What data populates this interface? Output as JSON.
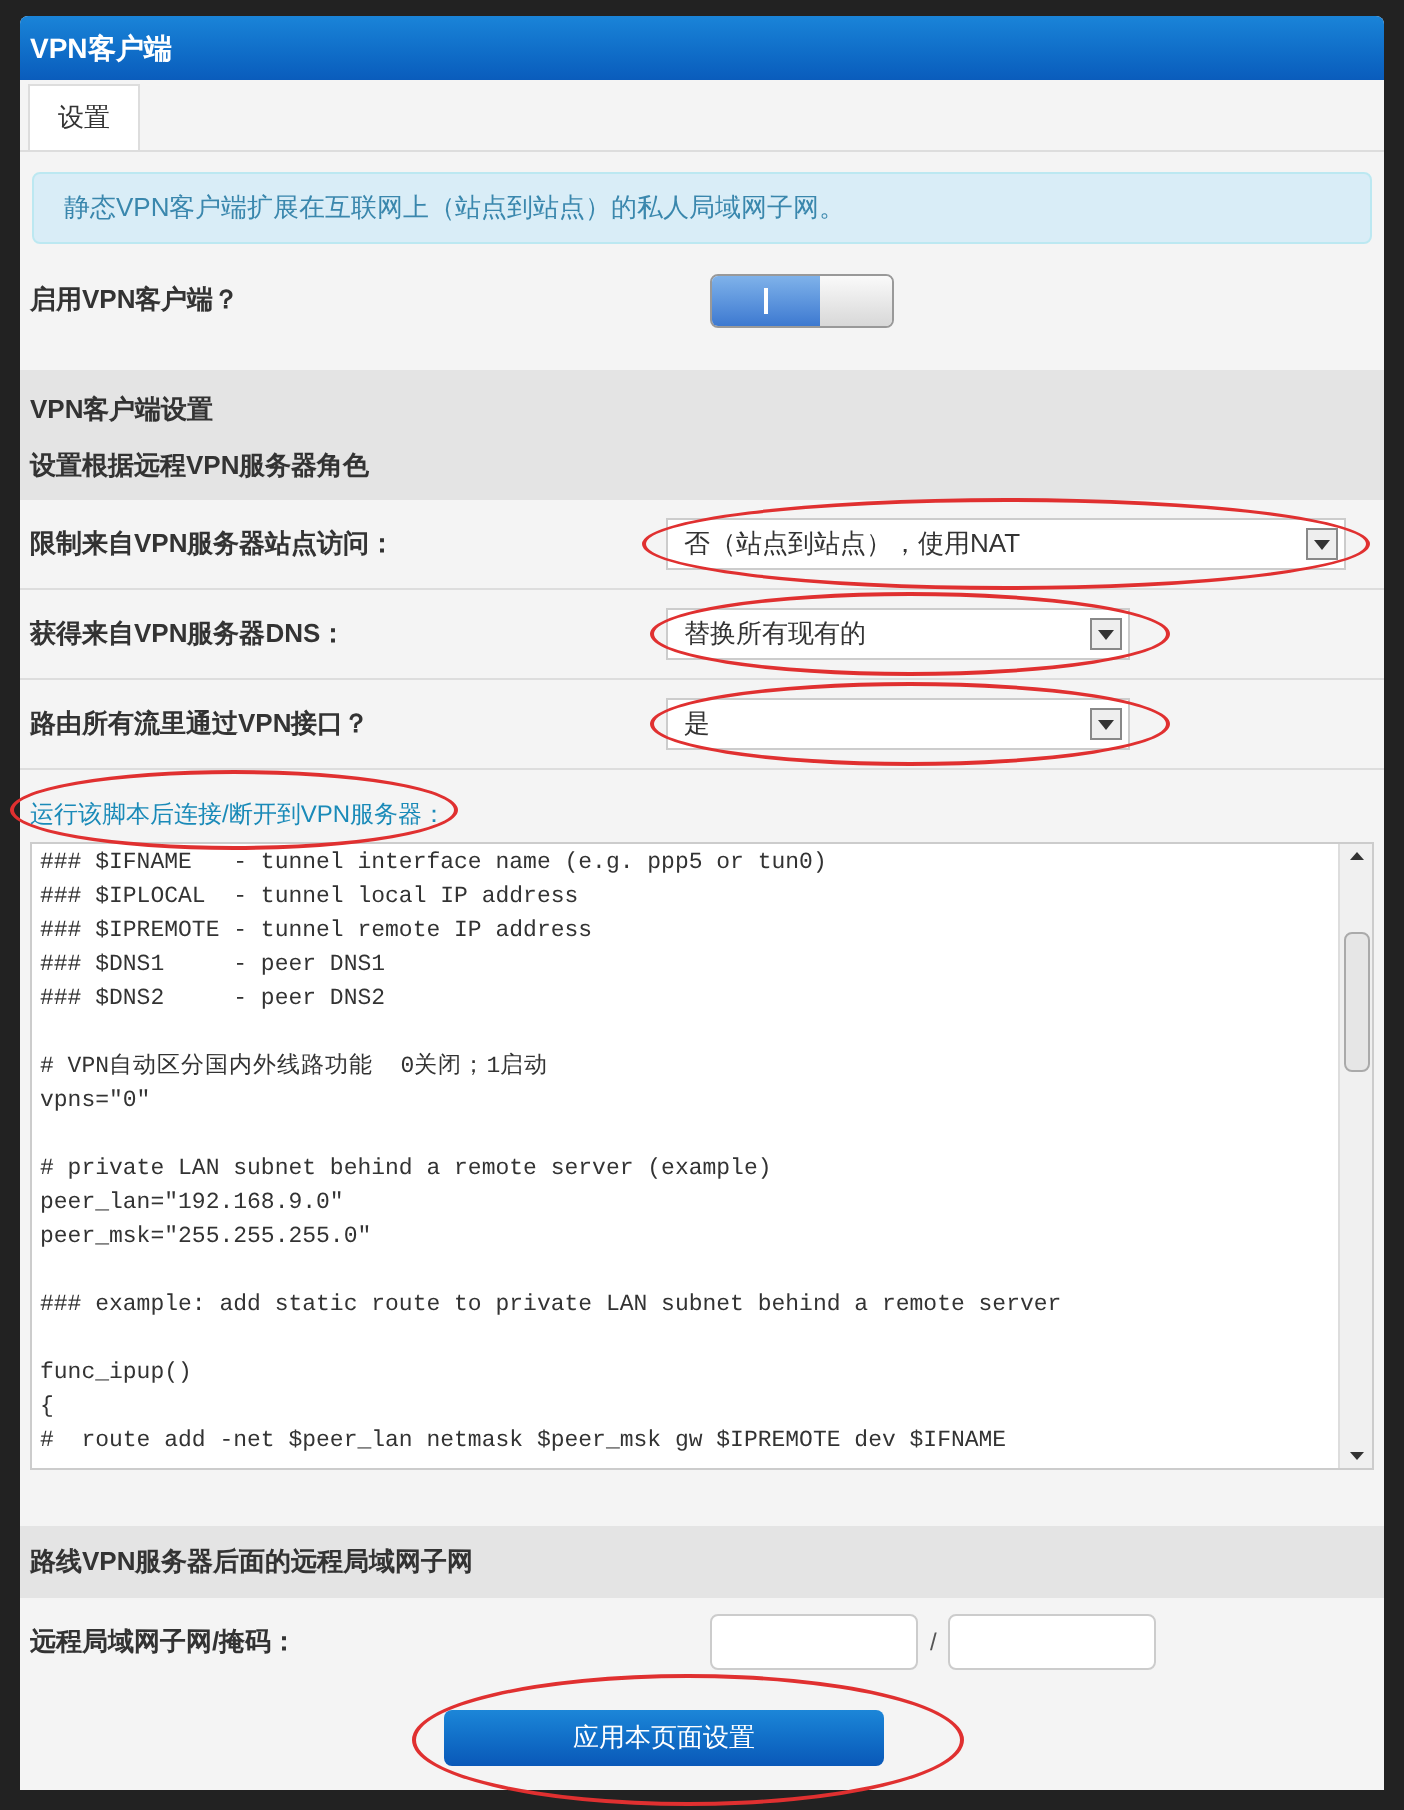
{
  "window": {
    "title": "VPN客户端"
  },
  "tabs": [
    {
      "label": "设置",
      "selected": true
    }
  ],
  "info": "静态VPN客户端扩展在互联网上（站点到站点）的私人局域网子网。",
  "enable": {
    "label": "启用VPN客户端？",
    "on": true
  },
  "section1": {
    "title": "VPN客户端设置",
    "subtitle": "设置根据远程VPN服务器角色"
  },
  "selects": [
    {
      "label": "限制来自VPN服务器站点访问：",
      "value": "否（站点到站点），使用NAT",
      "wide": true,
      "circled": true
    },
    {
      "label": "获得来自VPN服务器DNS：",
      "value": "替换所有现有的",
      "wide": false,
      "circled": true
    },
    {
      "label": "路由所有流里通过VPN接口？",
      "value": "是",
      "wide": false,
      "circled": true
    }
  ],
  "script": {
    "label": "运行该脚本后连接/断开到VPN服务器：",
    "blocks": [
      [
        "### $IFNAME   - tunnel interface name (e.g. ppp5 or tun0)",
        "### $IPLOCAL  - tunnel local IP address",
        "### $IPREMOTE - tunnel remote IP address",
        "### $DNS1     - peer DNS1",
        "### $DNS2     - peer DNS2"
      ],
      [
        "# VPN自动区分国内外线路功能  0关闭；1启动",
        "vpns=\"0\""
      ],
      [
        "# private LAN subnet behind a remote server (example)",
        "peer_lan=\"192.168.9.0\"",
        "peer_msk=\"255.255.255.0\""
      ],
      [
        "### example: add static route to private LAN subnet behind a remote server"
      ],
      [
        "func_ipup()",
        "{",
        "#  route add -net $peer_lan netmask $peer_msk gw $IPREMOTE dev $IFNAME"
      ]
    ]
  },
  "section2": {
    "title": "路线VPN服务器后面的远程局域网子网"
  },
  "subnet": {
    "label": "远程局域网子网/掩码：",
    "separator": "/"
  },
  "apply_button": "应用本页面设置"
}
